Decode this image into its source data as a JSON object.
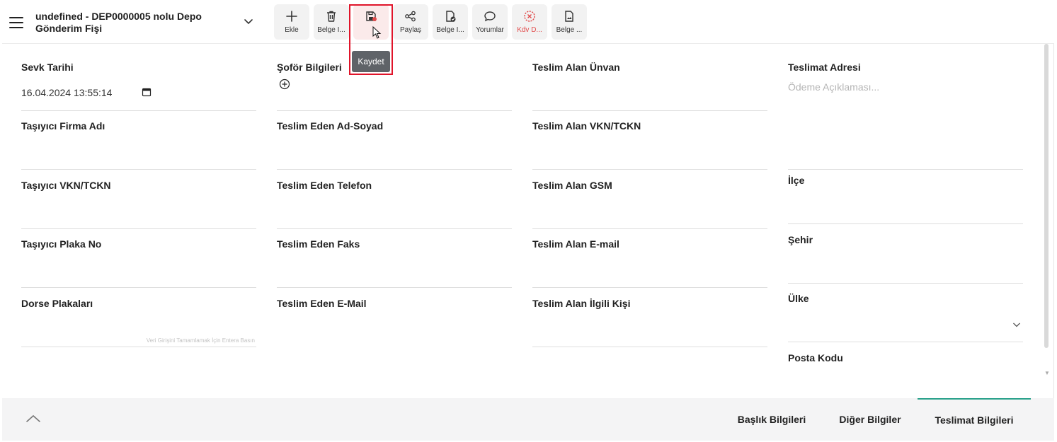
{
  "header": {
    "title": "undefined - DEP0000005 nolu Depo Gönderim Fişi"
  },
  "toolbar": {
    "buttons": [
      {
        "label": "Ekle",
        "icon": "plus-icon"
      },
      {
        "label": "Belge İ...",
        "icon": "trash-icon"
      },
      {
        "label": "",
        "icon": "save-icon"
      },
      {
        "label": "Paylaş",
        "icon": "share-icon"
      },
      {
        "label": "Belge İ...",
        "icon": "document-check-icon"
      },
      {
        "label": "Yorumlar",
        "icon": "comment-icon"
      },
      {
        "label": "Kdv D...",
        "icon": "cancel-circle-icon"
      },
      {
        "label": "Belge ...",
        "icon": "document-image-icon"
      }
    ],
    "tooltip": "Kaydet",
    "danger_color": "#e14b4b"
  },
  "form": {
    "col1": [
      {
        "label": "Sevk Tarihi",
        "value": "16.04.2024 13:55:14"
      },
      {
        "label": "Taşıyıcı Firma Adı"
      },
      {
        "label": "Taşıyıcı VKN/TCKN"
      },
      {
        "label": "Taşıyıcı Plaka No"
      },
      {
        "label": "Dorse Plakaları",
        "hint": "Veri Girişini Tamamlamak İçin Entera Basın"
      }
    ],
    "col2": [
      {
        "label": "Şoför Bilgileri"
      },
      {
        "label": "Teslim Eden Ad-Soyad"
      },
      {
        "label": "Teslim Eden Telefon"
      },
      {
        "label": "Teslim Eden Faks"
      },
      {
        "label": "Teslim Eden E-Mail"
      }
    ],
    "col3": [
      {
        "label": "Teslim Alan Ünvan"
      },
      {
        "label": "Teslim Alan VKN/TCKN"
      },
      {
        "label": "Teslim Alan GSM"
      },
      {
        "label": "Teslim Alan E-mail"
      },
      {
        "label": "Teslim Alan İlgili Kişi"
      }
    ],
    "col4": [
      {
        "label": "Teslimat Adresi",
        "placeholder": "Ödeme Açıklaması..."
      },
      {
        "label": "İlçe"
      },
      {
        "label": "Şehir"
      },
      {
        "label": "Ülke"
      },
      {
        "label": "Posta Kodu"
      }
    ]
  },
  "footer": {
    "tabs": [
      {
        "label": "Başlık Bilgileri"
      },
      {
        "label": "Diğer Bilgiler"
      },
      {
        "label": "Teslimat Bilgileri"
      }
    ],
    "accent": "#2aa18b"
  }
}
